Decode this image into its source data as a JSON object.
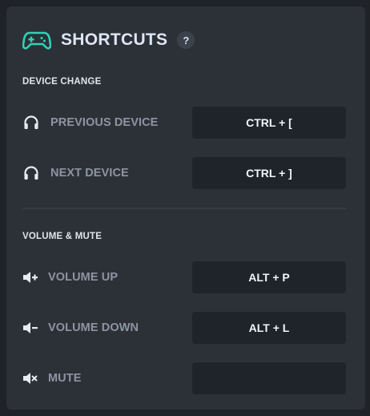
{
  "header": {
    "title": "SHORTCUTS",
    "help_label": "?",
    "icon": "gamepad-icon",
    "accent_color": "#2ed3b7"
  },
  "sections": {
    "device": {
      "title": "DEVICE CHANGE",
      "items": [
        {
          "label": "PREVIOUS DEVICE",
          "icon": "headphones-icon",
          "shortcut": "CTRL + ["
        },
        {
          "label": "NEXT DEVICE",
          "icon": "headphones-icon",
          "shortcut": "CTRL + ]"
        }
      ]
    },
    "volume": {
      "title": "VOLUME & MUTE",
      "items": [
        {
          "label": "VOLUME UP",
          "icon": "volume-up-icon",
          "shortcut": "ALT + P"
        },
        {
          "label": "VOLUME DOWN",
          "icon": "volume-down-icon",
          "shortcut": "ALT + L"
        },
        {
          "label": "MUTE",
          "icon": "mute-icon",
          "shortcut": ""
        }
      ]
    }
  }
}
